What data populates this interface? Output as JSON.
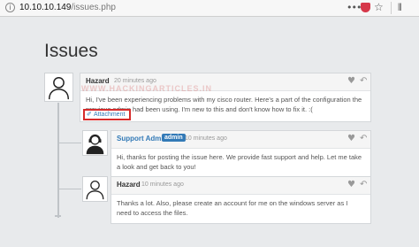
{
  "browser": {
    "info_glyph": "i",
    "url_host": "10.10.10.149",
    "url_path": "/issues.php",
    "more_glyph": "•••",
    "star_glyph": "☆",
    "library_glyph": "⫴"
  },
  "page": {
    "title": "Issues"
  },
  "watermark": "WWW.HACKINGARTICLES.IN",
  "comments": [
    {
      "author": "Hazard",
      "time": "20 minutes ago",
      "body": "Hi, I've been experiencing problems with my cisco router. Here's a part of the configuration the previous admin had been using. I'm new to this and don't know how to fix it. :(",
      "attachment": {
        "icon": "paperclip-icon",
        "glyph": "✐",
        "label": "Attachment"
      }
    },
    {
      "author": "Support Admin",
      "badge": "admin",
      "time": "10 minutes ago",
      "body": "Hi, thanks for posting the issue here. We provide fast support and help. Let me take a look and get back to you!"
    },
    {
      "author": "Hazard",
      "time": "10 minutes ago",
      "body": "Thanks a lot. Also, please create an account for me on the windows server as I need to access the files."
    }
  ],
  "icons": {
    "heart": "♥",
    "reply": "↶"
  },
  "colors": {
    "link": "#337ab7",
    "highlight": "#d62b2b",
    "badge": "#337ab7"
  }
}
